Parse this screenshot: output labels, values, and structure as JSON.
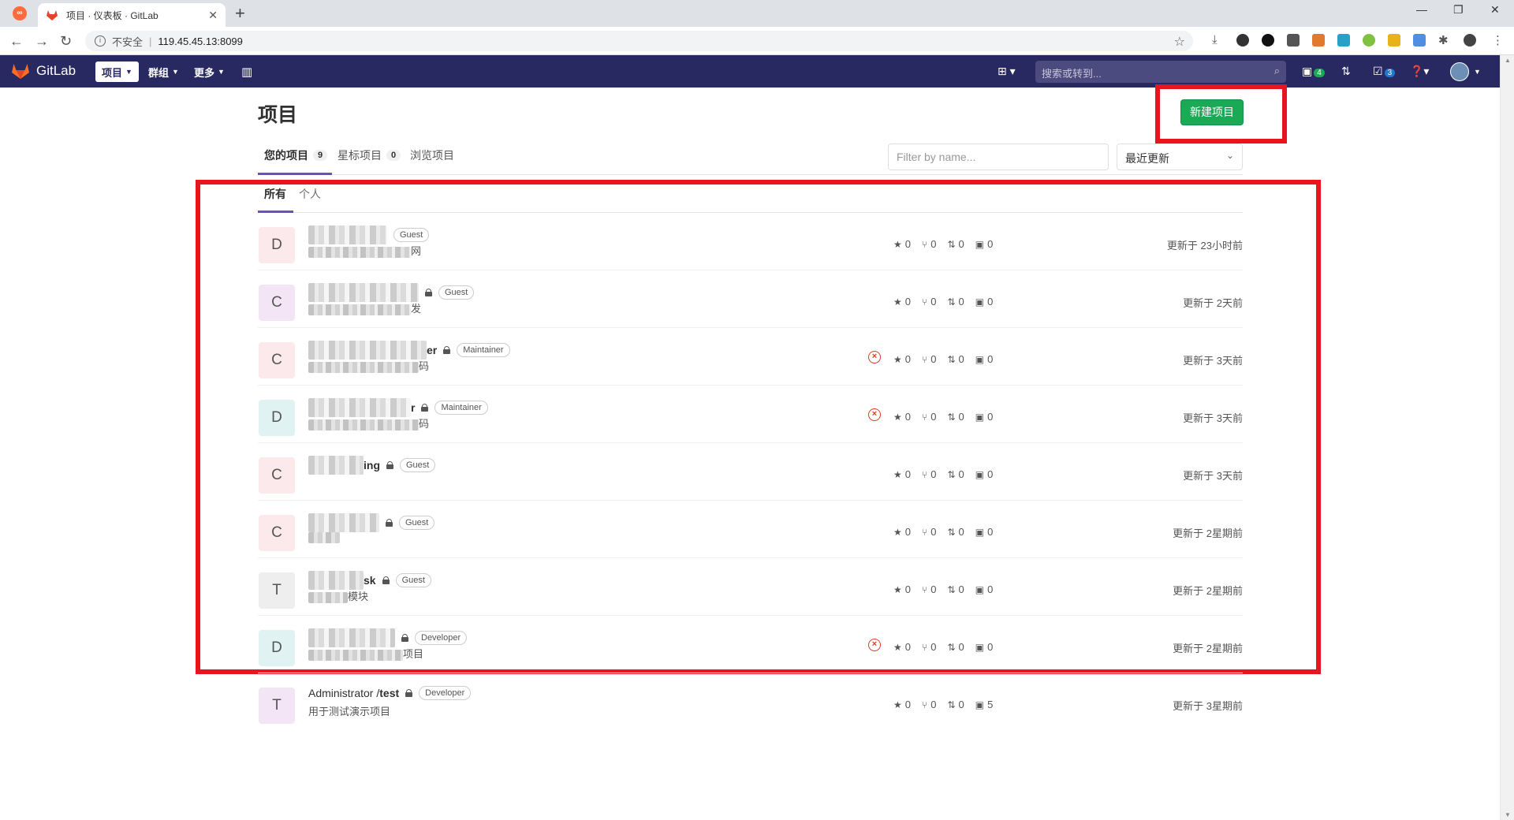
{
  "browser": {
    "tab_title": "项目 · 仪表板 · GitLab",
    "address_insecure": "不安全",
    "address_url": "119.45.45.13:8099"
  },
  "header": {
    "brand": "GitLab",
    "nav": [
      {
        "label": "项目"
      },
      {
        "label": "群组"
      },
      {
        "label": "更多"
      }
    ],
    "search_placeholder": "搜索或转到...",
    "issues_count": "4",
    "todos_count": "3"
  },
  "page": {
    "title": "项目",
    "new_project_label": "新建项目",
    "tabs": [
      {
        "label": "您的项目",
        "count": "9"
      },
      {
        "label": "星标项目",
        "count": "0"
      },
      {
        "label": "浏览项目"
      }
    ],
    "filter_placeholder": "Filter by name...",
    "sort_value": "最近更新",
    "subtabs": [
      {
        "label": "所有"
      },
      {
        "label": "个人"
      }
    ]
  },
  "projects": [
    {
      "avatar": "D",
      "avatar_color": "#fbe9eb",
      "name_visible": "",
      "role": "Guest",
      "desc_visible": "网",
      "stars": "0",
      "forks": "0",
      "mrs": "0",
      "issues": "0",
      "pipeline_failed": false,
      "updated": "更新于 23小时前"
    },
    {
      "avatar": "C",
      "avatar_color": "#f3e5f5",
      "name_visible": "",
      "role": "Guest",
      "desc_visible": "发",
      "stars": "0",
      "forks": "0",
      "mrs": "0",
      "issues": "0",
      "pipeline_failed": false,
      "updated": "更新于 2天前"
    },
    {
      "avatar": "C",
      "avatar_color": "#fbe9eb",
      "name_visible": "er",
      "role": "Maintainer",
      "desc_visible": "码",
      "stars": "0",
      "forks": "0",
      "mrs": "0",
      "issues": "0",
      "pipeline_failed": true,
      "updated": "更新于 3天前"
    },
    {
      "avatar": "D",
      "avatar_color": "#e0f2f1",
      "name_visible": "r",
      "role": "Maintainer",
      "desc_visible": "码",
      "stars": "0",
      "forks": "0",
      "mrs": "0",
      "issues": "0",
      "pipeline_failed": true,
      "updated": "更新于 3天前"
    },
    {
      "avatar": "C",
      "avatar_color": "#fbe9eb",
      "name_visible": "ing",
      "role": "Guest",
      "desc_visible": "",
      "stars": "0",
      "forks": "0",
      "mrs": "0",
      "issues": "0",
      "pipeline_failed": false,
      "updated": "更新于 3天前"
    },
    {
      "avatar": "C",
      "avatar_color": "#fbe9eb",
      "name_visible": "",
      "role": "Guest",
      "desc_visible": "",
      "stars": "0",
      "forks": "0",
      "mrs": "0",
      "issues": "0",
      "pipeline_failed": false,
      "updated": "更新于 2星期前"
    },
    {
      "avatar": "T",
      "avatar_color": "#eeeeee",
      "name_visible": "sk",
      "role": "Guest",
      "desc_visible": "模块",
      "stars": "0",
      "forks": "0",
      "mrs": "0",
      "issues": "0",
      "pipeline_failed": false,
      "updated": "更新于 2星期前"
    },
    {
      "avatar": "D",
      "avatar_color": "#e0f2f1",
      "name_visible": "",
      "role": "Developer",
      "desc_visible": "项目",
      "stars": "0",
      "forks": "0",
      "mrs": "0",
      "issues": "0",
      "pipeline_failed": true,
      "updated": "更新于 2星期前"
    },
    {
      "avatar": "T",
      "avatar_color": "#f3e5f5",
      "name_namespace": "Administrator / ",
      "name_project": "test",
      "role": "Developer",
      "desc_visible": "用于测试演示项目",
      "stars": "0",
      "forks": "0",
      "mrs": "0",
      "issues": "5",
      "pipeline_failed": false,
      "updated": "更新于 3星期前",
      "unredacted": true
    }
  ],
  "colors": {
    "header_bg": "#292961",
    "new_project_bg": "#1aaa55",
    "highlight": "#e8141f",
    "tab_underline": "#6b4fbb"
  }
}
